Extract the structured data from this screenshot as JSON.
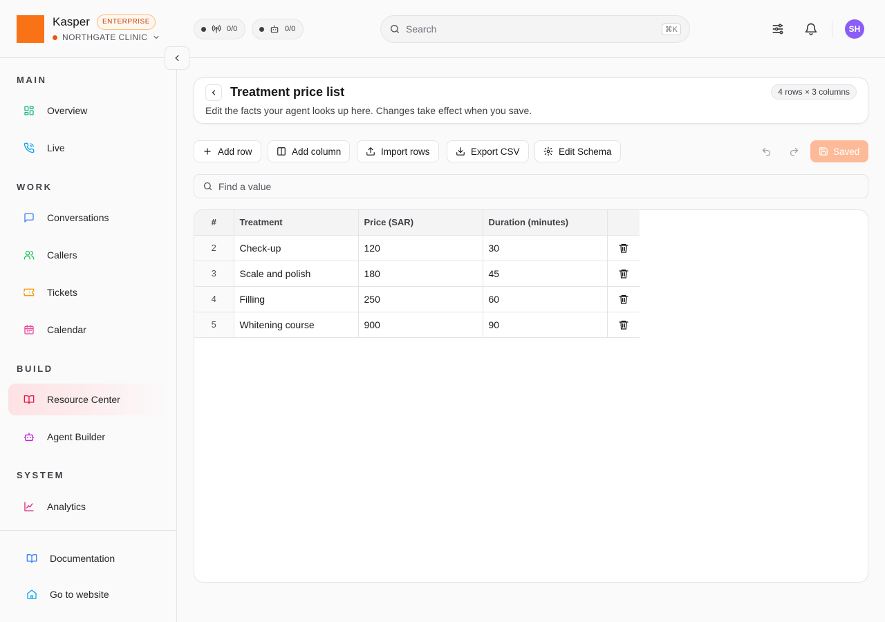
{
  "brand": {
    "name": "Kasper",
    "plan_badge": "ENTERPRISE",
    "org_name": "NORTHGATE CLINIC",
    "logo_color": "#f97316",
    "org_status_color": "#ea580c"
  },
  "header": {
    "stats": [
      {
        "icon": "antenna-icon",
        "value": "0/0"
      },
      {
        "icon": "bot-icon",
        "value": "0/0"
      }
    ],
    "search_placeholder": "Search",
    "search_shortcut": "⌘K",
    "user_initials": "SH",
    "avatar_color": "#8b5cf6"
  },
  "sidebar": {
    "sections": [
      {
        "label": "MAIN",
        "items": [
          {
            "label": "Overview",
            "icon": "dashboard-icon"
          },
          {
            "label": "Live",
            "icon": "phone-call-icon"
          }
        ]
      },
      {
        "label": "WORK",
        "items": [
          {
            "label": "Conversations",
            "icon": "chat-icon"
          },
          {
            "label": "Callers",
            "icon": "users-icon"
          },
          {
            "label": "Tickets",
            "icon": "ticket-icon"
          },
          {
            "label": "Calendar",
            "icon": "calendar-icon"
          }
        ]
      },
      {
        "label": "BUILD",
        "items": [
          {
            "label": "Resource Center",
            "icon": "book-icon",
            "active": true
          },
          {
            "label": "Agent Builder",
            "icon": "bot-icon"
          }
        ]
      },
      {
        "label": "SYSTEM",
        "items": [
          {
            "label": "Analytics",
            "icon": "chart-line-icon"
          }
        ]
      }
    ],
    "footer": [
      {
        "label": "Documentation",
        "icon": "book-open-icon"
      },
      {
        "label": "Go to website",
        "icon": "home-icon"
      }
    ]
  },
  "page": {
    "title": "Treatment price list",
    "size_badge": "4 rows × 3 columns",
    "description": "Edit the facts your agent looks up here. Changes take effect when you save."
  },
  "toolbar": {
    "add_row": "Add row",
    "add_column": "Add column",
    "import_rows": "Import rows",
    "export_csv": "Export CSV",
    "edit_schema": "Edit Schema",
    "saved": "Saved",
    "saved_color": "#fdba98"
  },
  "find": {
    "placeholder": "Find a value"
  },
  "table": {
    "headers": [
      "#",
      "Treatment",
      "Price (SAR)",
      "Duration (minutes)"
    ],
    "rows": [
      {
        "num": "2",
        "cells": [
          "Check-up",
          "120",
          "30"
        ]
      },
      {
        "num": "3",
        "cells": [
          "Scale and polish",
          "180",
          "45"
        ]
      },
      {
        "num": "4",
        "cells": [
          "Filling",
          "250",
          "60"
        ]
      },
      {
        "num": "5",
        "cells": [
          "Whitening course",
          "900",
          "90"
        ]
      }
    ]
  }
}
